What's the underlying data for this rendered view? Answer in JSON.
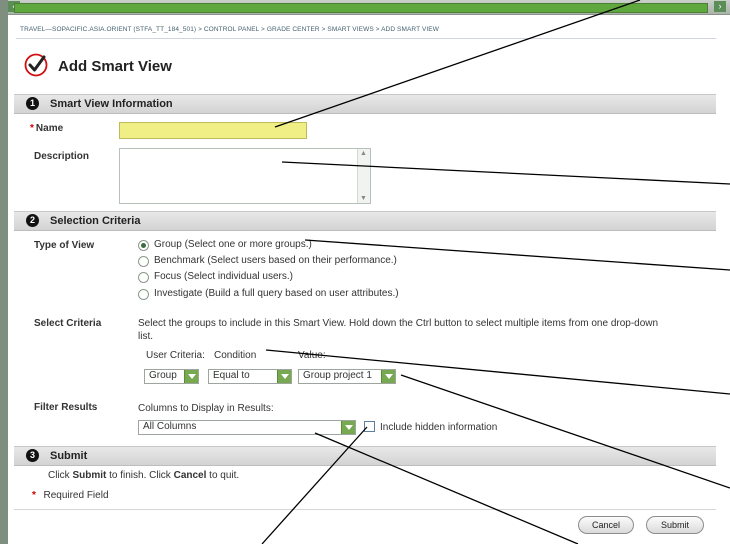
{
  "breadcrumb": "TRAVEL—SOPACIFIC.ASIA.ORIENT (STFA_TT_184_501) > CONTROL PANEL > GRADE CENTER > SMART VIEWS > ADD SMART VIEW",
  "page": {
    "title": "Add Smart View",
    "icon": "checkmark-icon"
  },
  "section1": {
    "number": "1",
    "title": "Smart View Information"
  },
  "name_field": {
    "label": "Name",
    "value": "",
    "required_marker": "*"
  },
  "description": {
    "label": "Description",
    "value": ""
  },
  "section2": {
    "number": "2",
    "title": "Selection Criteria"
  },
  "type_of_view": {
    "label": "Type of View",
    "options": [
      {
        "text": "Group (Select one or more groups.)",
        "selected": true
      },
      {
        "text": "Benchmark (Select users based on their performance.)",
        "selected": false
      },
      {
        "text": "Focus (Select individual users.)",
        "selected": false
      },
      {
        "text": "Investigate (Build a full query based on user attributes.)",
        "selected": false
      }
    ]
  },
  "select_criteria": {
    "label": "Select Criteria",
    "help_line1": "Select the groups to include in this Smart View. Hold down the Ctrl button to select multiple items from one drop-down",
    "help_line2": "list.",
    "user_criteria_label": "User Criteria:",
    "condition_label": "Condition",
    "value_label": "Value:",
    "user_criteria_value": "Group",
    "condition_value": "Equal to",
    "value_value": "Group project 1"
  },
  "filter_results": {
    "label": "Filter Results",
    "columns_label": "Columns to Display in Results:",
    "columns_value": "All Columns",
    "include_hidden_label": "Include hidden information",
    "include_hidden_checked": false
  },
  "section3": {
    "number": "3",
    "title": "Submit"
  },
  "submit_info": {
    "part1": "Click ",
    "submit_word": "Submit",
    "part2": " to finish. Click ",
    "cancel_word": "Cancel",
    "part3": " to quit."
  },
  "required_note": {
    "marker": "*",
    "text": "Required Field"
  },
  "buttons": {
    "cancel": "Cancel",
    "submit": "Submit"
  },
  "colors": {
    "accent_green": "#5fa83e",
    "name_field_bg": "#f0ef85",
    "section_bar": "#d3d3d3",
    "required_red": "#d40000"
  }
}
